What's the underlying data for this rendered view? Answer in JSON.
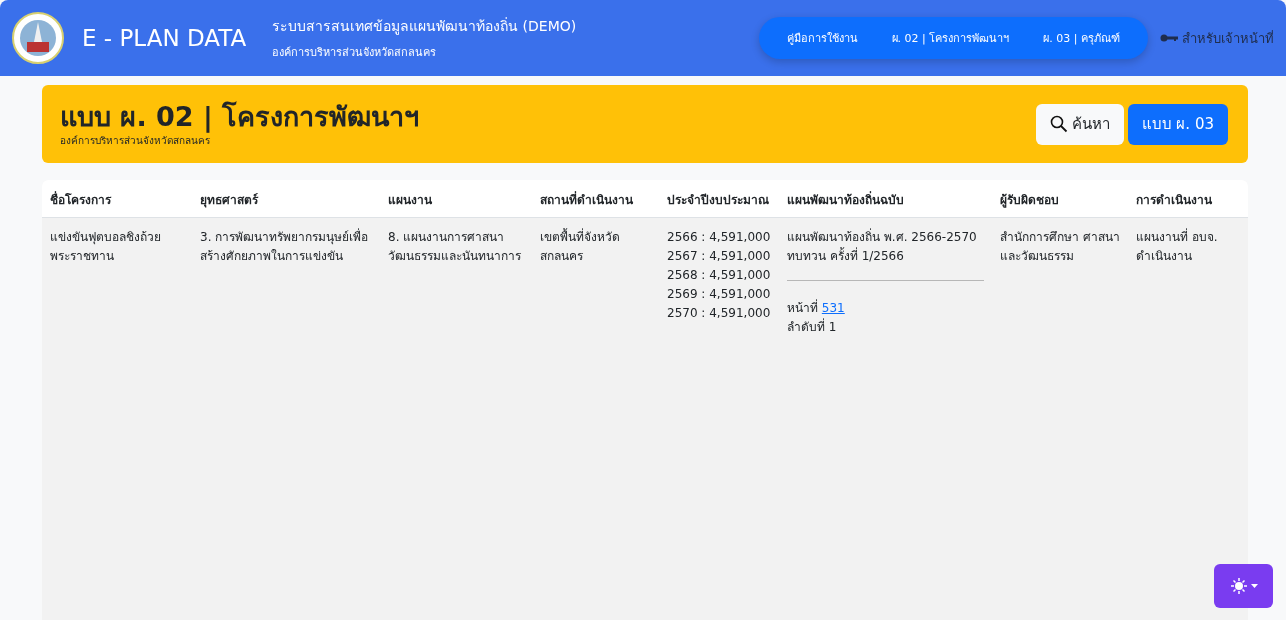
{
  "header": {
    "brand": "E - PLAN DATA",
    "system_title": "ระบบสารสนเทศข้อมูลแผนพัฒนาท้องถิ่น (DEMO)",
    "organization": "องค์การบริหารส่วนจังหวัดสกลนคร",
    "nav": [
      {
        "label": "คู่มือการใช้งาน"
      },
      {
        "label": "ผ. 02 | โครงการพัฒนาฯ"
      },
      {
        "label": "ผ. 03 | ครุภัณฑ์"
      }
    ],
    "staff_link": "สำหรับเจ้าหน้าที่"
  },
  "banner": {
    "title": "แบบ ผ. 02 | โครงการพัฒนาฯ",
    "subtitle": "องค์การบริหารส่วนจังหวัดสกลนคร",
    "search_button": "ค้นหา",
    "form_button": "แบบ ผ. 03"
  },
  "table": {
    "columns": [
      "ชื่อโครงการ",
      "ยุทธศาสตร์",
      "แผนงาน",
      "สถานที่ดำเนินงาน",
      "ประจำปีงบประมาณ",
      "แผนพัฒนาท้องถิ่นฉบับ",
      "ผู้รับผิดชอบ",
      "การดำเนินงาน"
    ],
    "rows": [
      {
        "project": "แข่งขันฟุตบอลชิงถ้วยพระราชทาน",
        "strategy": "3. การพัฒนาทรัพยากรมนุษย์เพื่อสร้างศักยภาพในการแข่งขัน",
        "plan": "8. แผนงานการศาสนาวัฒนธรรมและนันทนาการ",
        "location": "เขตพื้นที่จังหวัดสกลนคร",
        "budgets": [
          "2566 : 4,591,000",
          "2567 : 4,591,000",
          "2568 : 4,591,000",
          "2569 : 4,591,000",
          "2570 : 4,591,000"
        ],
        "plan_edition": "แผนพัฒนาท้องถิ่น พ.ศ. 2566-2570 ทบทวน ครั้งที่ 1/2566",
        "page_label": "หน้าที่",
        "page_link": "531",
        "order": "ลำดับที่ 1",
        "responsible": "สำนักการศึกษา ศาสนาและวัฒนธรรม",
        "operation": "แผนงานที่ อบจ. ดำเนินงาน"
      }
    ]
  }
}
